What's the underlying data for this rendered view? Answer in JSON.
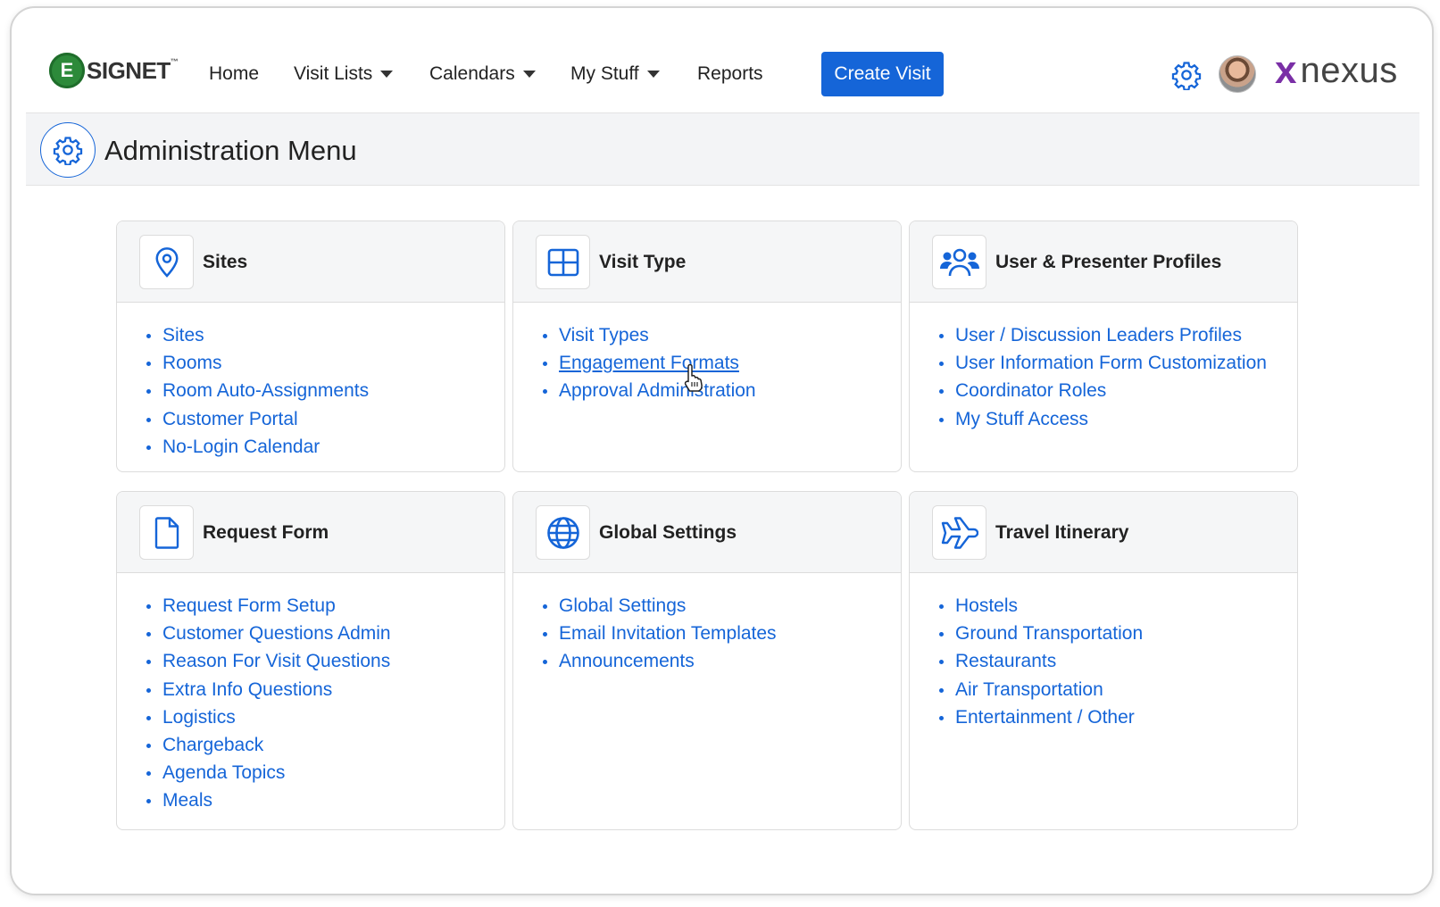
{
  "brand": {
    "logo_letter": "E",
    "logo_text": "SIGNET",
    "logo_tm": "™",
    "partner_x": "x",
    "partner_text": "nexus"
  },
  "nav": {
    "home": "Home",
    "visit_lists": "Visit Lists",
    "calendars": "Calendars",
    "my_stuff": "My Stuff",
    "reports": "Reports",
    "create_visit": "Create Visit"
  },
  "page": {
    "title": "Administration Menu"
  },
  "colors": {
    "accent": "#1565d8",
    "brand_green": "#2d8a3a",
    "partner_purple": "#7a2fa6"
  },
  "cards": [
    {
      "title": "Sites",
      "icon": "map-pin-icon",
      "links": [
        "Sites",
        "Rooms",
        "Room Auto-Assignments",
        "Customer Portal",
        "No-Login Calendar"
      ]
    },
    {
      "title": "Visit Type",
      "icon": "grid-icon",
      "links": [
        "Visit Types",
        "Engagement Formats",
        "Approval Administration"
      ]
    },
    {
      "title": "User & Presenter Profiles",
      "icon": "users-icon",
      "links": [
        "User / Discussion Leaders Profiles",
        "User Information Form Customization",
        "Coordinator Roles",
        "My Stuff Access"
      ]
    },
    {
      "title": "Request Form",
      "icon": "document-icon",
      "links": [
        "Request Form Setup",
        "Customer Questions Admin",
        "Reason For Visit Questions",
        "Extra Info Questions",
        "Logistics",
        "Chargeback",
        "Agenda Topics",
        "Meals"
      ]
    },
    {
      "title": "Global Settings",
      "icon": "globe-icon",
      "links": [
        "Global Settings",
        "Email Invitation Templates",
        "Announcements"
      ]
    },
    {
      "title": "Travel Itinerary",
      "icon": "airplane-icon",
      "links": [
        "Hostels",
        "Ground Transportation",
        "Restaurants",
        "Air Transportation",
        "Entertainment / Other"
      ]
    }
  ]
}
